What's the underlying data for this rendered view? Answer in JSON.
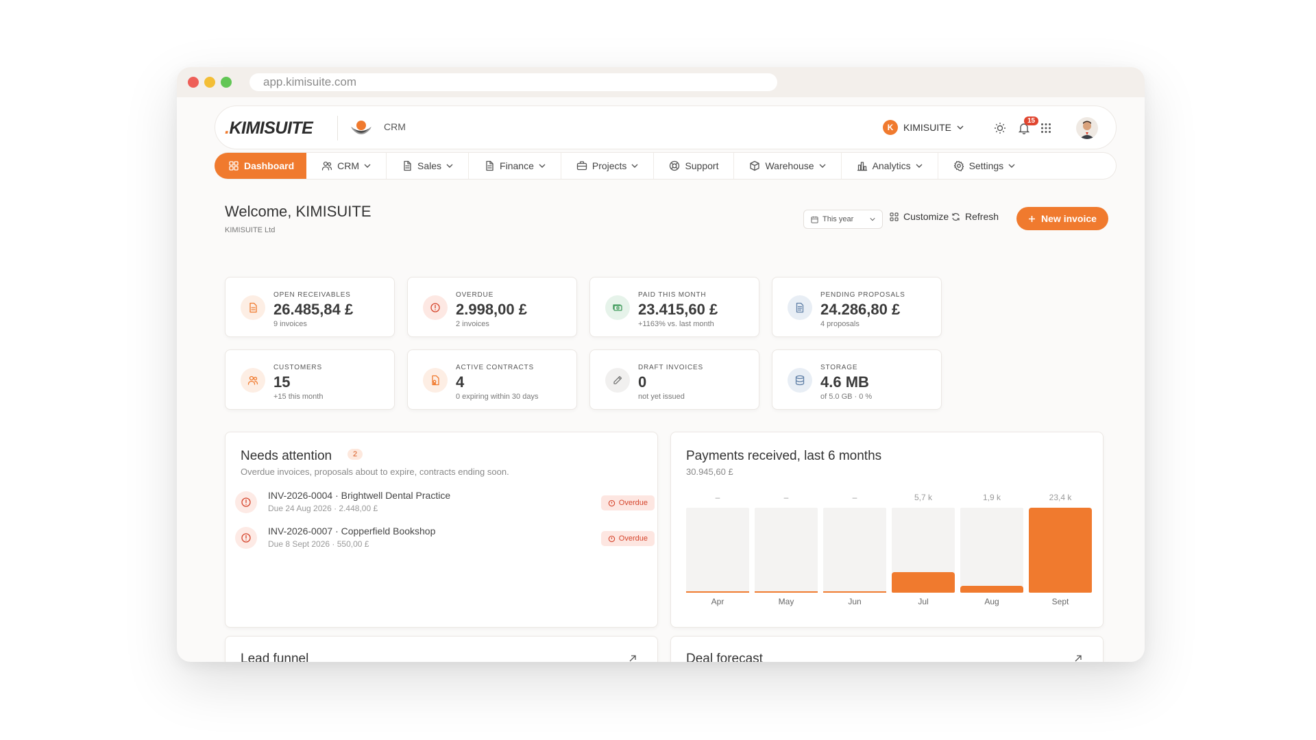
{
  "browser": {
    "url": "app.kimisuite.com"
  },
  "header": {
    "logo": "KIMISUITE",
    "app_label": "CRM",
    "org_initial": "K",
    "org_name": "KIMISUITE",
    "notification_count": "15"
  },
  "nav": [
    {
      "label": "Dashboard",
      "icon": "grid-icon",
      "active": true
    },
    {
      "label": "CRM",
      "icon": "users-icon"
    },
    {
      "label": "Sales",
      "icon": "document-icon"
    },
    {
      "label": "Finance",
      "icon": "document-icon"
    },
    {
      "label": "Projects",
      "icon": "briefcase-icon"
    },
    {
      "label": "Support",
      "icon": "lifebuoy-icon"
    },
    {
      "label": "Warehouse",
      "icon": "box-icon"
    },
    {
      "label": "Analytics",
      "icon": "bar-chart-icon"
    },
    {
      "label": "Settings",
      "icon": "gear-icon"
    }
  ],
  "page": {
    "welcome": "Welcome, KIMISUITE",
    "company": "KIMISUITE Ltd",
    "period": "This year",
    "customize": "Customize",
    "refresh": "Refresh",
    "new_invoice": "New invoice"
  },
  "kpis": [
    {
      "label": "OPEN RECEIVABLES",
      "value": "26.485,84 £",
      "sub": "9 invoices",
      "icon": "invoice-icon",
      "color": "#f07a2e",
      "bg": "#fdeee4"
    },
    {
      "label": "OVERDUE",
      "value": "2.998,00 £",
      "sub": "2 invoices",
      "icon": "alert-icon",
      "color": "#d5432a",
      "bg": "#fde8e3"
    },
    {
      "label": "PAID THIS MONTH",
      "value": "23.415,60 £",
      "sub": "+1163% vs. last month",
      "icon": "cash-icon",
      "color": "#3f9a5a",
      "bg": "#e6f3ea"
    },
    {
      "label": "PENDING PROPOSALS",
      "value": "24.286,80 £",
      "sub": "4 proposals",
      "icon": "file-icon",
      "color": "#5f7fa6",
      "bg": "#e8eef5"
    },
    {
      "label": "CUSTOMERS",
      "value": "15",
      "sub": "+15 this month",
      "icon": "users-icon",
      "color": "#f07a2e",
      "bg": "#fdeee4"
    },
    {
      "label": "ACTIVE CONTRACTS",
      "value": "4",
      "sub": "0 expiring within 30 days",
      "icon": "contract-icon",
      "color": "#f07a2e",
      "bg": "#fdeee4"
    },
    {
      "label": "DRAFT INVOICES",
      "value": "0",
      "sub": "not yet issued",
      "icon": "pencil-icon",
      "color": "#777777",
      "bg": "#f1f0ef"
    },
    {
      "label": "STORAGE",
      "value": "4.6 MB",
      "sub": "of 5.0 GB · 0 %",
      "icon": "database-icon",
      "color": "#5f7fa6",
      "bg": "#e8eef5"
    }
  ],
  "attention": {
    "title": "Needs attention",
    "count": "2",
    "subtitle": "Overdue invoices, proposals about to expire, contracts ending soon.",
    "items": [
      {
        "title": "INV-2026-0004 · Brightwell Dental Practice",
        "sub": "Due 24 Aug 2026 · 2.448,00 £",
        "badge": "Overdue"
      },
      {
        "title": "INV-2026-0007 · Copperfield Bookshop",
        "sub": "Due 8 Sept 2026 · 550,00 £",
        "badge": "Overdue"
      }
    ]
  },
  "payments": {
    "title": "Payments received, last 6 months",
    "total": "30.945,60 £"
  },
  "chart_data": {
    "type": "bar",
    "title": "Payments received, last 6 months",
    "categories": [
      "Apr",
      "May",
      "Jun",
      "Jul",
      "Aug",
      "Sept"
    ],
    "values": [
      0,
      0,
      0,
      5.7,
      1.9,
      23.4
    ],
    "data_labels": [
      "–",
      "–",
      "–",
      "5,7 k",
      "1,9 k",
      "23,4 k"
    ],
    "ylim": [
      0,
      23.4
    ],
    "grid": false,
    "color": "#f07a2e"
  },
  "bottom": {
    "lead_funnel": "Lead funnel",
    "deal_forecast": "Deal forecast"
  }
}
